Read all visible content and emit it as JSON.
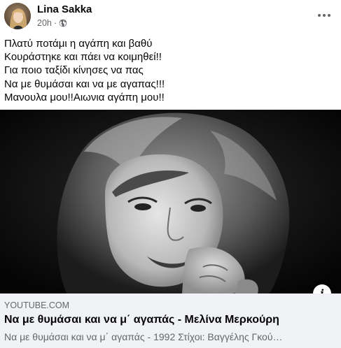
{
  "header": {
    "author_name": "Lina Sakka",
    "timestamp": "20h",
    "separator": "·",
    "privacy_icon": "globe-icon",
    "more_icon": "more-horizontal-icon"
  },
  "post": {
    "lines": [
      "Πλατύ ποτάμι η αγάπη και βαθύ",
      "Κουράστηκε και πάει να κοιμηθεί!!",
      "Για ποιο ταξίδι κίνησες να πας",
      "Να με θυμάσαι και να με αγαπας!!!",
      "Μανουλα μου!!Αιωνια αγάπη μου!!"
    ]
  },
  "link": {
    "domain": "YOUTUBE.COM",
    "title": "Να με θυμάσαι και να μ΄ αγαπάς - Μελίνα Μερκούρη",
    "description": "Να με θυμάσαι και να μ΄ αγαπάς - 1992 Στίχοι: Βαγγέλης Γκού…",
    "info_label": "i",
    "image_subject": "black-and-white portrait photo"
  },
  "colors": {
    "text_primary": "#050505",
    "text_secondary": "#65676b",
    "preview_background": "#f0f2f5"
  }
}
